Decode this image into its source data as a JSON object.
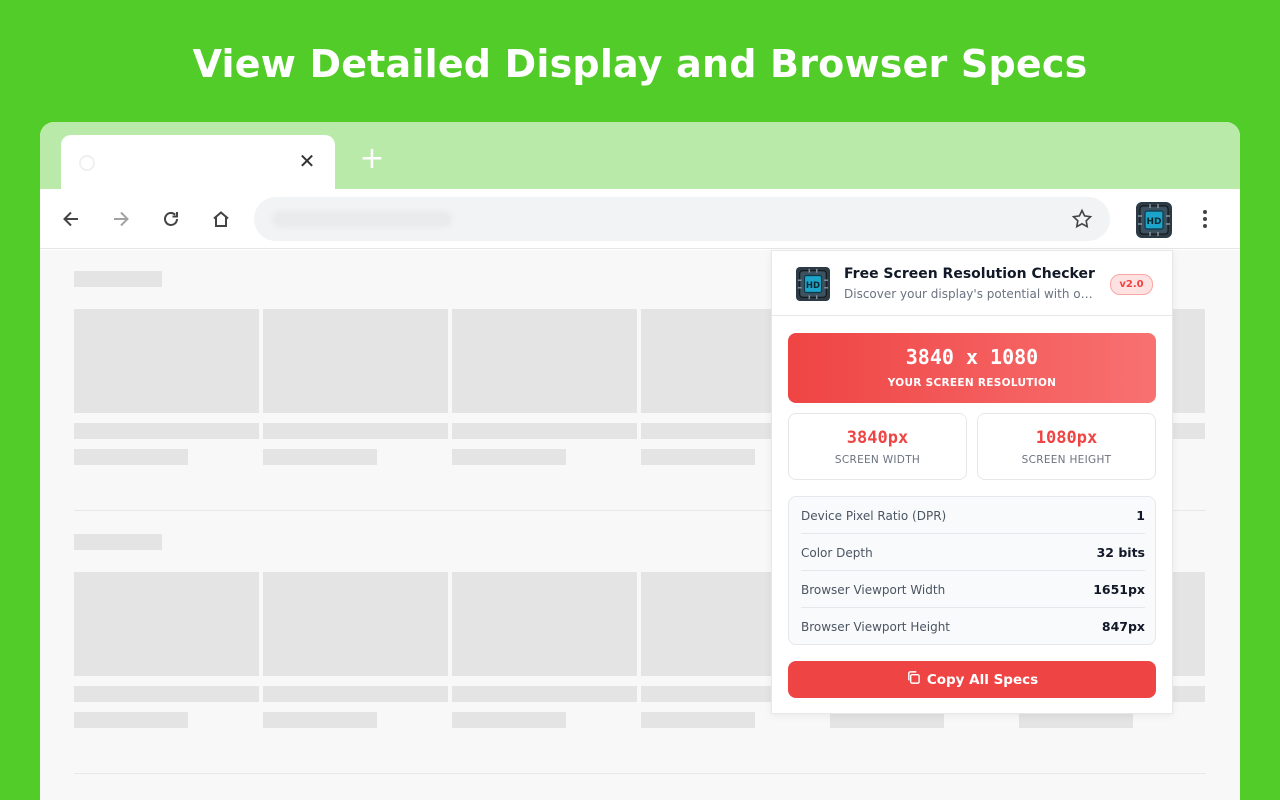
{
  "headline": "View Detailed Display and Browser Specs",
  "browser": {
    "tab_close_icon": "close-icon",
    "new_tab_icon": "plus-icon",
    "toolbar_icons": [
      "back-arrow-icon",
      "forward-arrow-icon",
      "reload-icon",
      "home-icon",
      "star-icon",
      "extension-icon",
      "kebab-menu-icon"
    ]
  },
  "popup": {
    "title": "Free Screen Resolution Checker",
    "subtitle": "Discover your display's potential with our ...",
    "version": "v2.0",
    "resolution": {
      "value": "3840 x 1080",
      "label": "YOUR SCREEN RESOLUTION"
    },
    "width": {
      "value": "3840px",
      "label": "SCREEN WIDTH"
    },
    "height": {
      "value": "1080px",
      "label": "SCREEN HEIGHT"
    },
    "specs": [
      {
        "label": "Device Pixel Ratio (DPR)",
        "value": "1"
      },
      {
        "label": "Color Depth",
        "value": "32 bits"
      },
      {
        "label": "Browser Viewport Width",
        "value": "1651px"
      },
      {
        "label": "Browser Viewport Height",
        "value": "847px"
      }
    ],
    "copy_button": "Copy All Specs"
  },
  "colors": {
    "page_background": "#52cc28",
    "tab_strip": "#b9eaa9",
    "accent_red": "#ef4444"
  }
}
